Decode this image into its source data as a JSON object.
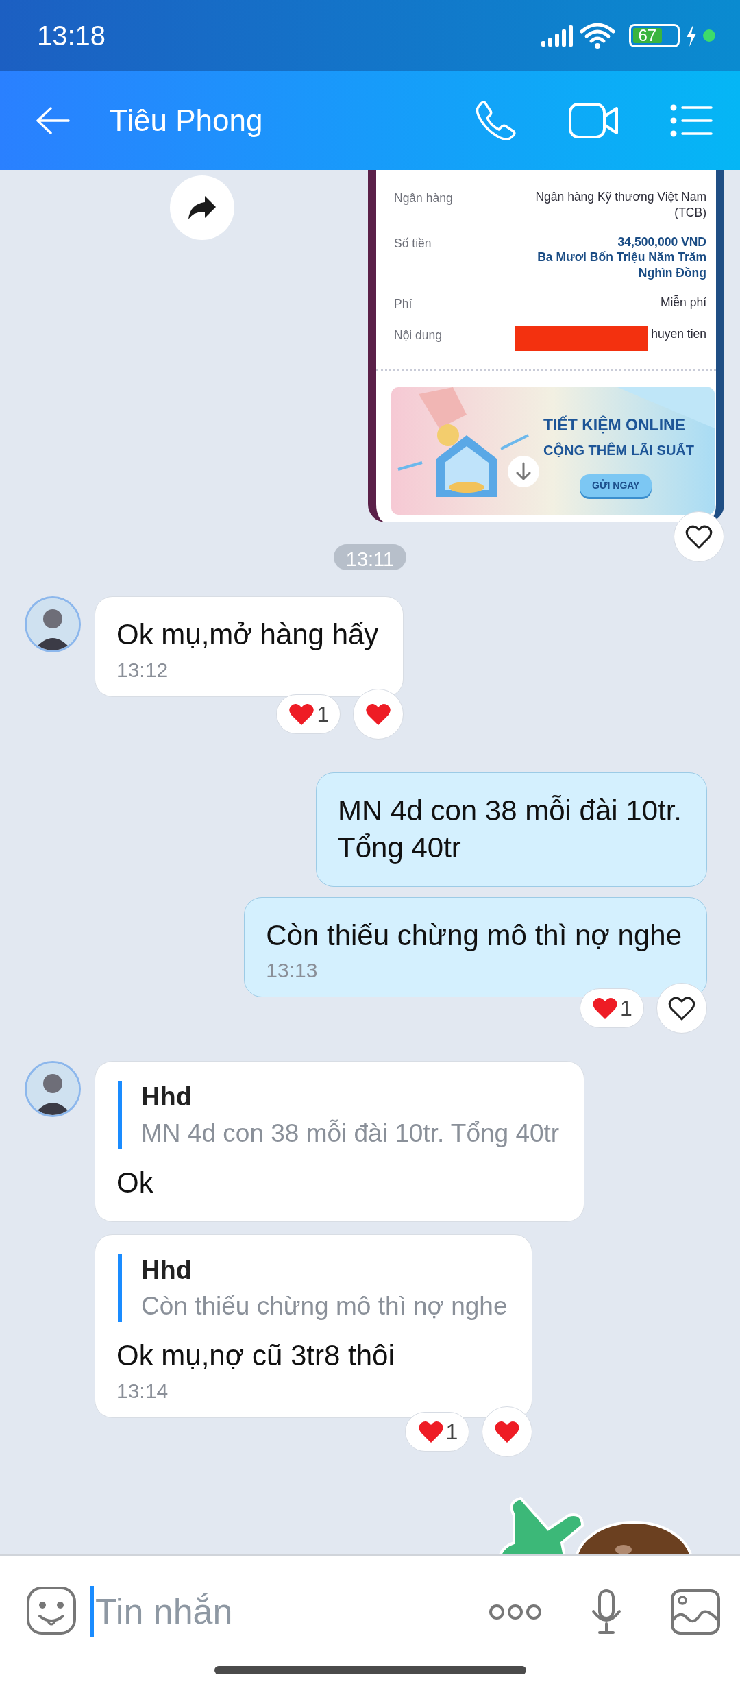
{
  "status_bar": {
    "time": "13:18",
    "battery": "67",
    "charging": true
  },
  "header": {
    "title": "Tiêu Phong"
  },
  "messages": [
    {
      "outgoing": true,
      "liked": false,
      "receipt": {
        "rows": [
          {
            "label": "Ngân hàng",
            "lines": [
              "Ngân hàng Kỹ thương Việt Nam",
              "(TCB)"
            ],
            "emphasis": false,
            "redacted": false
          },
          {
            "label": "Số tiền",
            "lines": [
              "34,500,000 VND",
              "Ba Mươi Bốn Triệu Năm Trăm",
              "Nghìn Đồng"
            ],
            "emphasis": true,
            "redacted": false
          },
          {
            "label": "Phí",
            "lines": [
              "Miễn phí"
            ],
            "emphasis": false,
            "redacted": false
          },
          {
            "label": "Nội dung",
            "lines": [
              "huyen tien"
            ],
            "emphasis": false,
            "redacted": true
          }
        ],
        "banner": {
          "headline": "TIẾT KIỆM ONLINE",
          "subline": "CỘNG THÊM LÃI SUẤT",
          "button": "GỬI NGAY"
        }
      }
    },
    {
      "kind": "time_separator",
      "text": "13:11"
    },
    {
      "kind": "text",
      "outgoing": false,
      "avatar": true,
      "text": "Ok mụ,mở hàng hấy",
      "time": "13:12",
      "reaction_count": "1",
      "liked": true
    },
    {
      "kind": "text",
      "outgoing": true,
      "text": "MN 4d con 38 mỗi đài 10tr.\nTổng 40tr"
    },
    {
      "kind": "text",
      "outgoing": true,
      "text": "Còn thiếu chừng mô thì nợ nghe",
      "time": "13:13",
      "reaction_count": "1",
      "liked": false
    },
    {
      "kind": "reply",
      "outgoing": false,
      "avatar": true,
      "quote_author": "Hhd",
      "quote_text": "MN 4d con 38 mỗi đài 10tr. Tổng 40tr",
      "text": "Ok"
    },
    {
      "kind": "reply",
      "outgoing": false,
      "avatar": false,
      "quote_author": "Hhd",
      "quote_text": "Còn thiếu chừng mô thì nợ nghe",
      "text": "Ok mụ,nợ cũ 3tr8 thôi",
      "time": "13:14",
      "reaction_count": "1",
      "liked": true
    },
    {
      "kind": "sticker",
      "outgoing": true
    }
  ],
  "composer": {
    "placeholder": "Tin nhắn"
  }
}
